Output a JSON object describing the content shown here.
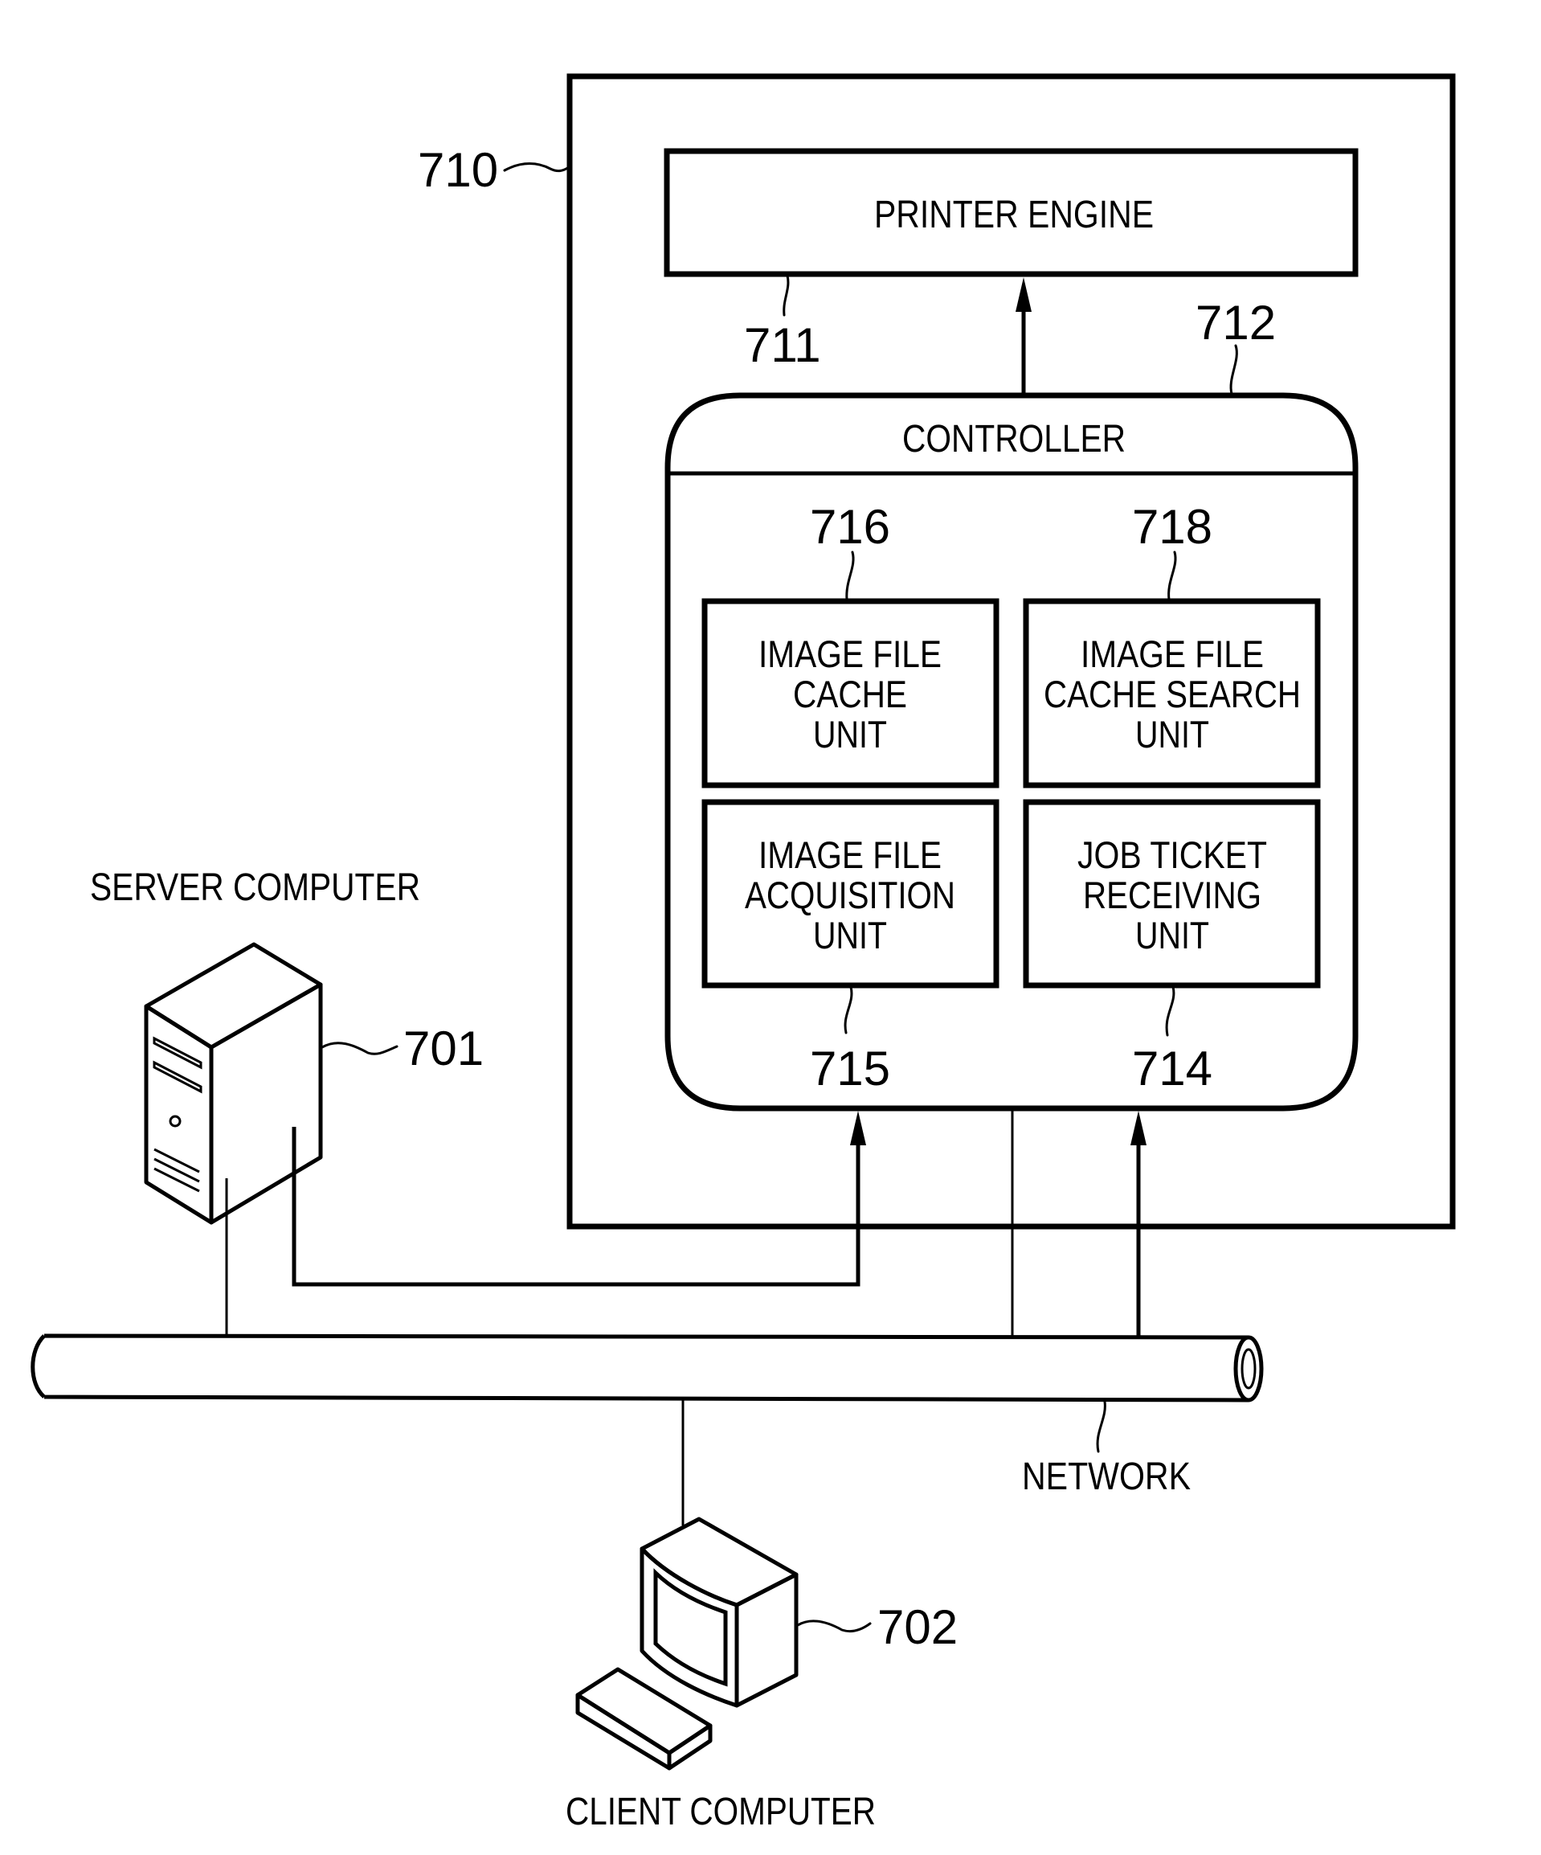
{
  "figure": {
    "printer": {
      "ref": "710",
      "printer_engine": {
        "label": "PRINTER ENGINE",
        "ref": "711"
      },
      "controller": {
        "label": "CONTROLLER",
        "ref": "712",
        "units": [
          {
            "id": "image-file-cache-unit",
            "lines": [
              "IMAGE FILE",
              "CACHE",
              "UNIT"
            ],
            "ref": "716"
          },
          {
            "id": "image-file-cache-search-unit",
            "lines": [
              "IMAGE FILE",
              "CACHE SEARCH",
              "UNIT"
            ],
            "ref": "718"
          },
          {
            "id": "image-file-acquisition-unit",
            "lines": [
              "IMAGE FILE",
              "ACQUISITION",
              "UNIT"
            ],
            "ref": "715"
          },
          {
            "id": "job-ticket-receiving-unit",
            "lines": [
              "JOB TICKET",
              "RECEIVING",
              "UNIT"
            ],
            "ref": "714"
          }
        ]
      }
    },
    "server": {
      "label": "SERVER COMPUTER",
      "ref": "701",
      "icon": "server-tower-icon"
    },
    "client": {
      "label": "CLIENT COMPUTER",
      "ref": "702",
      "icon": "desktop-computer-icon"
    },
    "network": {
      "label": "NETWORK",
      "icon": "network-pipe-icon"
    }
  }
}
